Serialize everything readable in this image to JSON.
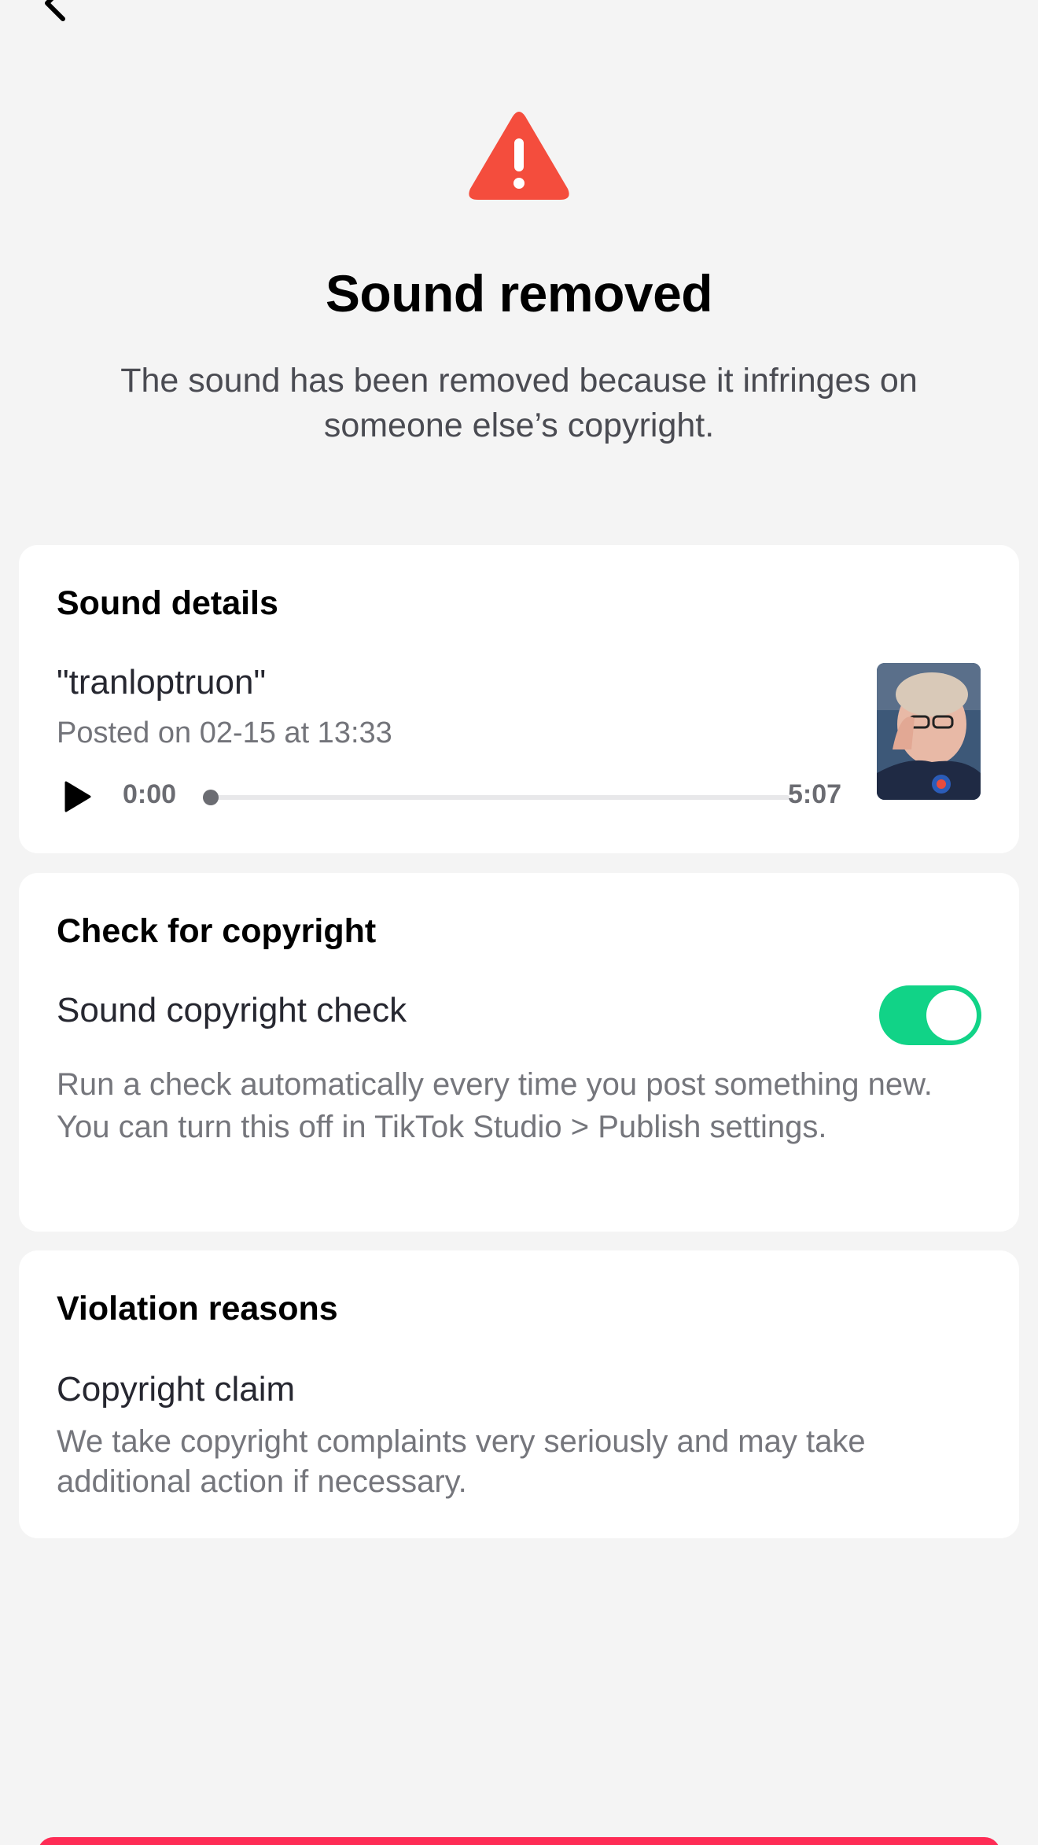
{
  "header": {
    "back_icon": "chevron-left-icon"
  },
  "status": {
    "icon": "warning-triangle-icon",
    "icon_color": "#f44d3d",
    "title": "Sound removed",
    "description": "The sound has been removed because it infringes on someone else’s copyright."
  },
  "sound_details": {
    "heading": "Sound details",
    "name": "\"tranloptruon\"",
    "posted": "Posted on 02-15 at 13:33",
    "player": {
      "play_icon": "play-icon",
      "current_time": "0:00",
      "duration": "5:07",
      "progress": 0
    },
    "thumbnail": "sound-cover-image"
  },
  "copyright_check": {
    "heading": "Check for copyright",
    "toggle_label": "Sound copyright check",
    "toggle_on": true,
    "toggle_color": "#11d387",
    "description": "Run a check automatically every time you post something new. You can turn this off in TikTok Studio > Publish settings."
  },
  "violation": {
    "heading": "Violation reasons",
    "reason": "Copyright claim",
    "description": "We take copyright complaints very seriously and may take additional action if necessary."
  },
  "footer": {
    "button_color": "#fe2c55"
  }
}
